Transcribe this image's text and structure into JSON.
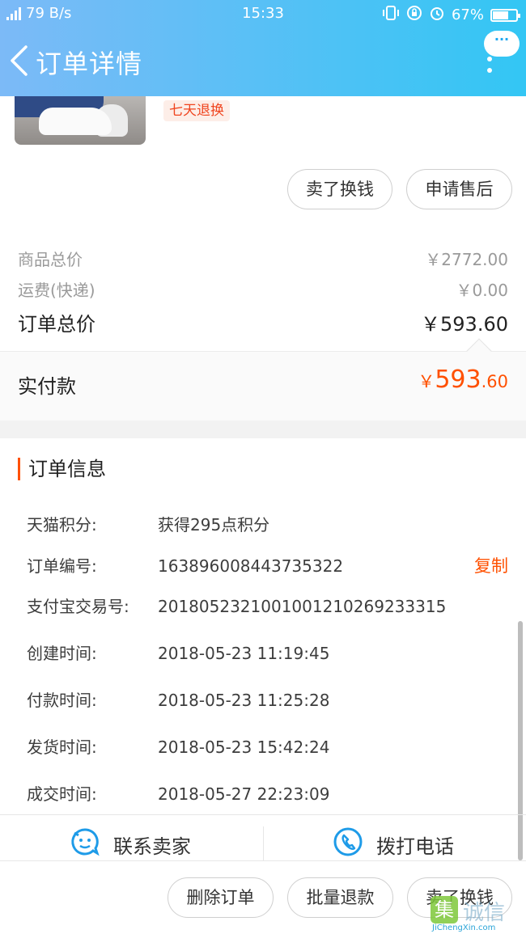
{
  "status_bar": {
    "network": "4G",
    "speed": "79 B/s",
    "time": "15:33",
    "battery_percent": "67%",
    "battery_level": 0.67
  },
  "header": {
    "title": "订单详情",
    "more_label": "···"
  },
  "product": {
    "tag": "七天退换"
  },
  "item_actions": {
    "sell_label": "卖了换钱",
    "after_sale_label": "申请售后"
  },
  "price": {
    "goods_total_label": "商品总价",
    "goods_total_value": "￥2772.00",
    "shipping_label": "运费(快递)",
    "shipping_value": "￥0.00",
    "order_total_label": "订单总价",
    "order_total_value": "￥593.60",
    "paid_label": "实付款",
    "paid_currency": "￥",
    "paid_integer": "593",
    "paid_decimal": ".60"
  },
  "order_info": {
    "title": "订单信息",
    "rows": [
      {
        "label": "天猫积分:",
        "value": "获得295点积分"
      },
      {
        "label": "订单编号:",
        "value": "163896008443735322"
      },
      {
        "label": "支付宝交易号:",
        "value": "2018052321001001210269233315"
      },
      {
        "label": "创建时间:",
        "value": "2018-05-23 11:19:45"
      },
      {
        "label": "付款时间:",
        "value": "2018-05-23 11:25:28"
      },
      {
        "label": "发货时间:",
        "value": "2018-05-23 15:42:24"
      },
      {
        "label": "成交时间:",
        "value": "2018-05-27 22:23:09"
      }
    ],
    "copy_label": "复制"
  },
  "contact": {
    "seller_label": "联系卖家",
    "phone_label": "拨打电话"
  },
  "bottom_bar": {
    "delete_label": "删除订单",
    "batch_refund_label": "批量退款",
    "sell_label": "卖了换钱"
  },
  "watermark": {
    "mark": "集",
    "text": "诚信",
    "url": "JiChengXin.com"
  },
  "colors": {
    "accent": "#ff5000",
    "header_start": "#7cbaf7",
    "header_end": "#33c6f4",
    "contact_icon": "#1e9be8"
  }
}
